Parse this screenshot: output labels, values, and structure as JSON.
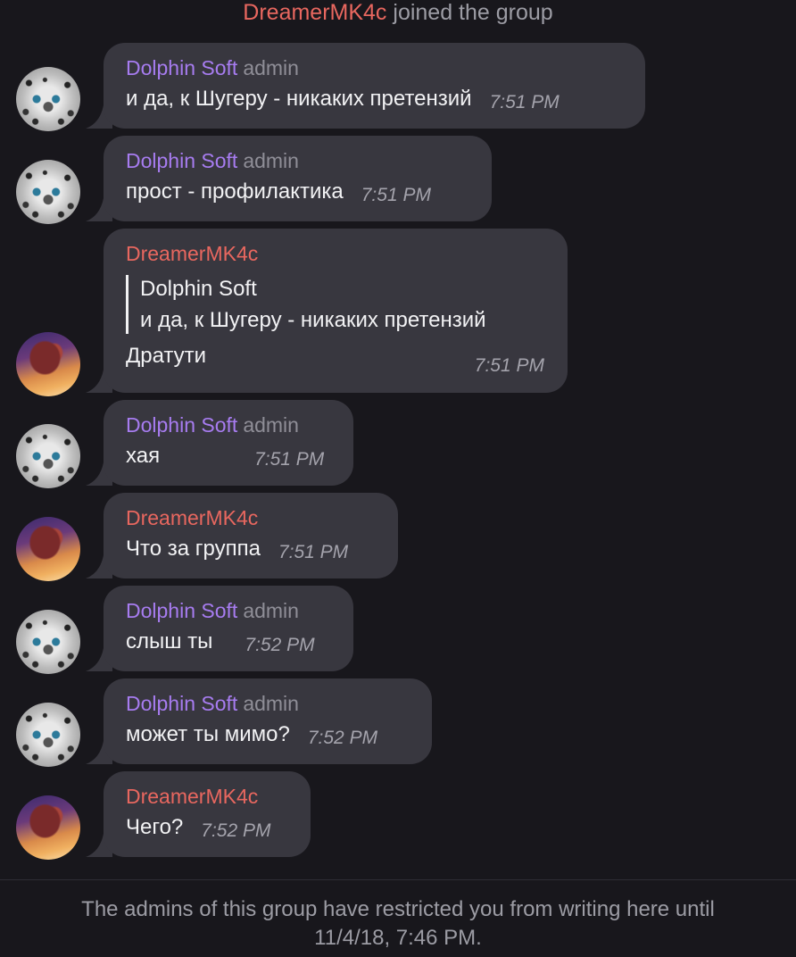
{
  "service_message": {
    "name": "DreamerMK4c",
    "text": " joined the group"
  },
  "messages": [
    {
      "sender": "Dolphin Soft",
      "role": "admin",
      "text": "и да, к Шугеру - никаких претензий",
      "time": "7:51 PM"
    },
    {
      "sender": "Dolphin Soft",
      "role": "admin",
      "text": "прост - профилактика",
      "time": "7:51 PM"
    },
    {
      "sender": "DreamerMK4c",
      "reply_to_name": "Dolphin Soft",
      "reply_to_text": "и да, к Шугеру - никаких претензий",
      "text": "Дратути",
      "time": "7:51 PM"
    },
    {
      "sender": "Dolphin Soft",
      "role": "admin",
      "text": "хая",
      "time": "7:51 PM"
    },
    {
      "sender": "DreamerMK4c",
      "text": "Что за группа",
      "time": "7:51 PM"
    },
    {
      "sender": "Dolphin Soft",
      "role": "admin",
      "text": "слыш ты",
      "time": "7:52 PM"
    },
    {
      "sender": "Dolphin Soft",
      "role": "admin",
      "text": "может ты мимо?",
      "time": "7:52 PM"
    },
    {
      "sender": "DreamerMK4c",
      "text": "Чего?",
      "time": "7:52 PM"
    }
  ],
  "footer": {
    "line1": "The admins of this group have restricted you from writing here until",
    "line2": "11/4/18, 7:46 PM."
  },
  "colors": {
    "background": "#18171c",
    "bubble": "#38373f",
    "dolphin_name": "#a77cf0",
    "dreamer_name": "#e8675f",
    "text": "#f2f2f4",
    "meta": "#a4a3ac"
  },
  "icons": {
    "dolphin_avatar": "snow-leopard-avatar-icon",
    "dreamer_avatar": "fox-sunset-avatar-icon"
  }
}
